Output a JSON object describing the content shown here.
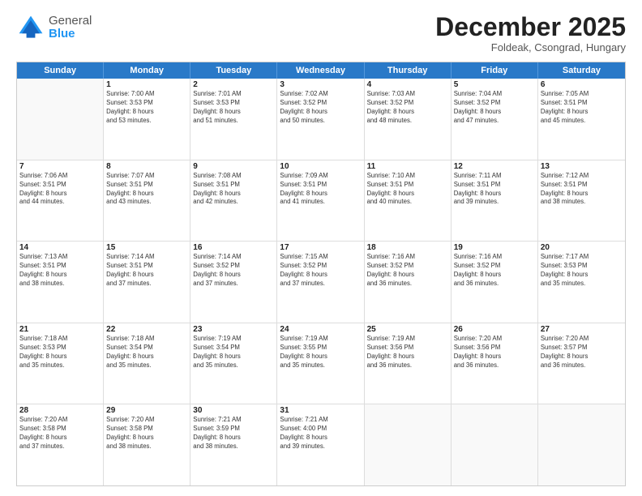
{
  "header": {
    "logo_general": "General",
    "logo_blue": "Blue",
    "month_title": "December 2025",
    "location": "Foldeak, Csongrad, Hungary"
  },
  "days_of_week": [
    "Sunday",
    "Monday",
    "Tuesday",
    "Wednesday",
    "Thursday",
    "Friday",
    "Saturday"
  ],
  "weeks": [
    [
      {
        "day": "",
        "info": ""
      },
      {
        "day": "1",
        "info": "Sunrise: 7:00 AM\nSunset: 3:53 PM\nDaylight: 8 hours\nand 53 minutes."
      },
      {
        "day": "2",
        "info": "Sunrise: 7:01 AM\nSunset: 3:53 PM\nDaylight: 8 hours\nand 51 minutes."
      },
      {
        "day": "3",
        "info": "Sunrise: 7:02 AM\nSunset: 3:52 PM\nDaylight: 8 hours\nand 50 minutes."
      },
      {
        "day": "4",
        "info": "Sunrise: 7:03 AM\nSunset: 3:52 PM\nDaylight: 8 hours\nand 48 minutes."
      },
      {
        "day": "5",
        "info": "Sunrise: 7:04 AM\nSunset: 3:52 PM\nDaylight: 8 hours\nand 47 minutes."
      },
      {
        "day": "6",
        "info": "Sunrise: 7:05 AM\nSunset: 3:51 PM\nDaylight: 8 hours\nand 45 minutes."
      }
    ],
    [
      {
        "day": "7",
        "info": "Sunrise: 7:06 AM\nSunset: 3:51 PM\nDaylight: 8 hours\nand 44 minutes."
      },
      {
        "day": "8",
        "info": "Sunrise: 7:07 AM\nSunset: 3:51 PM\nDaylight: 8 hours\nand 43 minutes."
      },
      {
        "day": "9",
        "info": "Sunrise: 7:08 AM\nSunset: 3:51 PM\nDaylight: 8 hours\nand 42 minutes."
      },
      {
        "day": "10",
        "info": "Sunrise: 7:09 AM\nSunset: 3:51 PM\nDaylight: 8 hours\nand 41 minutes."
      },
      {
        "day": "11",
        "info": "Sunrise: 7:10 AM\nSunset: 3:51 PM\nDaylight: 8 hours\nand 40 minutes."
      },
      {
        "day": "12",
        "info": "Sunrise: 7:11 AM\nSunset: 3:51 PM\nDaylight: 8 hours\nand 39 minutes."
      },
      {
        "day": "13",
        "info": "Sunrise: 7:12 AM\nSunset: 3:51 PM\nDaylight: 8 hours\nand 38 minutes."
      }
    ],
    [
      {
        "day": "14",
        "info": "Sunrise: 7:13 AM\nSunset: 3:51 PM\nDaylight: 8 hours\nand 38 minutes."
      },
      {
        "day": "15",
        "info": "Sunrise: 7:14 AM\nSunset: 3:51 PM\nDaylight: 8 hours\nand 37 minutes."
      },
      {
        "day": "16",
        "info": "Sunrise: 7:14 AM\nSunset: 3:52 PM\nDaylight: 8 hours\nand 37 minutes."
      },
      {
        "day": "17",
        "info": "Sunrise: 7:15 AM\nSunset: 3:52 PM\nDaylight: 8 hours\nand 37 minutes."
      },
      {
        "day": "18",
        "info": "Sunrise: 7:16 AM\nSunset: 3:52 PM\nDaylight: 8 hours\nand 36 minutes."
      },
      {
        "day": "19",
        "info": "Sunrise: 7:16 AM\nSunset: 3:52 PM\nDaylight: 8 hours\nand 36 minutes."
      },
      {
        "day": "20",
        "info": "Sunrise: 7:17 AM\nSunset: 3:53 PM\nDaylight: 8 hours\nand 35 minutes."
      }
    ],
    [
      {
        "day": "21",
        "info": "Sunrise: 7:18 AM\nSunset: 3:53 PM\nDaylight: 8 hours\nand 35 minutes."
      },
      {
        "day": "22",
        "info": "Sunrise: 7:18 AM\nSunset: 3:54 PM\nDaylight: 8 hours\nand 35 minutes."
      },
      {
        "day": "23",
        "info": "Sunrise: 7:19 AM\nSunset: 3:54 PM\nDaylight: 8 hours\nand 35 minutes."
      },
      {
        "day": "24",
        "info": "Sunrise: 7:19 AM\nSunset: 3:55 PM\nDaylight: 8 hours\nand 35 minutes."
      },
      {
        "day": "25",
        "info": "Sunrise: 7:19 AM\nSunset: 3:56 PM\nDaylight: 8 hours\nand 36 minutes."
      },
      {
        "day": "26",
        "info": "Sunrise: 7:20 AM\nSunset: 3:56 PM\nDaylight: 8 hours\nand 36 minutes."
      },
      {
        "day": "27",
        "info": "Sunrise: 7:20 AM\nSunset: 3:57 PM\nDaylight: 8 hours\nand 36 minutes."
      }
    ],
    [
      {
        "day": "28",
        "info": "Sunrise: 7:20 AM\nSunset: 3:58 PM\nDaylight: 8 hours\nand 37 minutes."
      },
      {
        "day": "29",
        "info": "Sunrise: 7:20 AM\nSunset: 3:58 PM\nDaylight: 8 hours\nand 38 minutes."
      },
      {
        "day": "30",
        "info": "Sunrise: 7:21 AM\nSunset: 3:59 PM\nDaylight: 8 hours\nand 38 minutes."
      },
      {
        "day": "31",
        "info": "Sunrise: 7:21 AM\nSunset: 4:00 PM\nDaylight: 8 hours\nand 39 minutes."
      },
      {
        "day": "",
        "info": ""
      },
      {
        "day": "",
        "info": ""
      },
      {
        "day": "",
        "info": ""
      }
    ]
  ]
}
